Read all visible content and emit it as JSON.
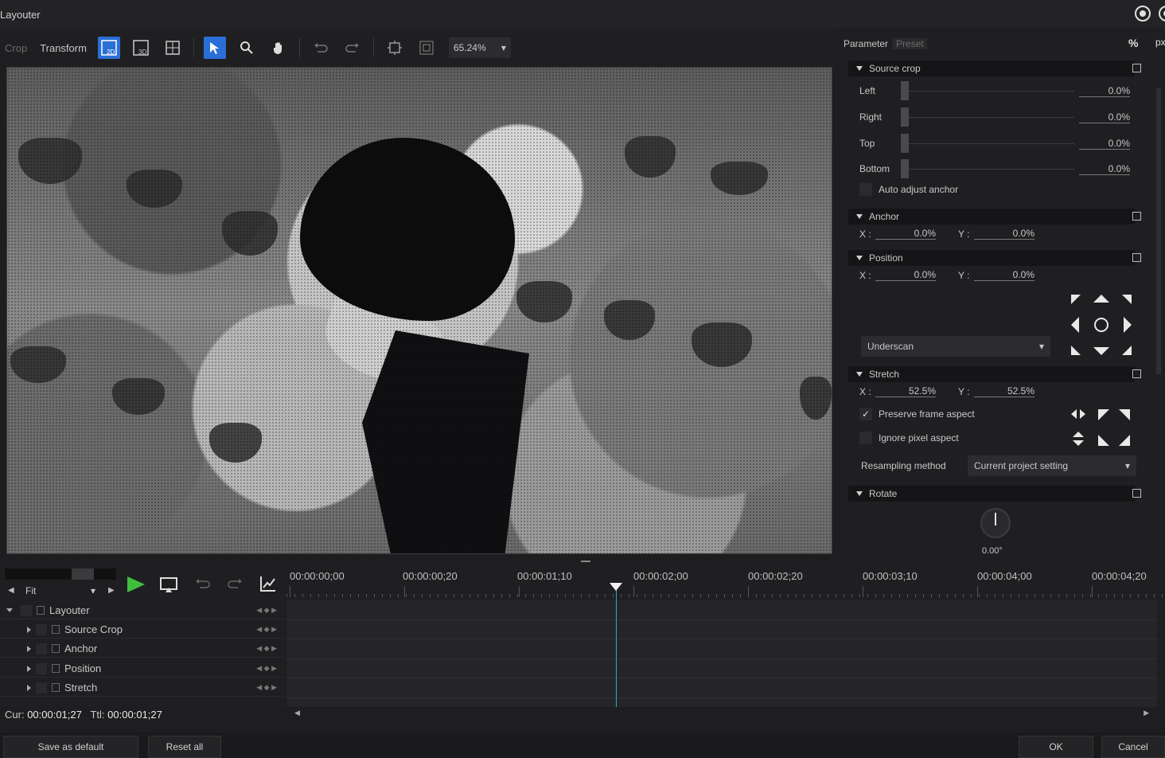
{
  "window": {
    "title": "Layouter"
  },
  "toolbar": {
    "crop_label": "Crop",
    "transform_label": "Transform",
    "zoom": "65.24%",
    "icons": [
      "view-2d-icon",
      "view-3d-icon",
      "grid-icon",
      "select-arrow-icon",
      "zoom-icon",
      "hand-icon",
      "undo-icon",
      "redo-icon",
      "fit-frame-icon",
      "safe-area-icon"
    ]
  },
  "panel": {
    "tab_parameter": "Parameter",
    "tab_preset": "Preset",
    "unit_percent": "%",
    "unit_px": "px",
    "source_crop": {
      "title": "Source crop",
      "left_label": "Left",
      "left_value": "0.0%",
      "right_label": "Right",
      "right_value": "0.0%",
      "top_label": "Top",
      "top_value": "0.0%",
      "bottom_label": "Bottom",
      "bottom_value": "0.0%",
      "auto_adjust_label": "Auto adjust anchor"
    },
    "anchor": {
      "title": "Anchor",
      "x_label": "X :",
      "x_value": "0.0%",
      "y_label": "Y :",
      "y_value": "0.0%"
    },
    "position": {
      "title": "Position",
      "x_label": "X :",
      "x_value": "0.0%",
      "y_label": "Y :",
      "y_value": "0.0%",
      "fit_mode": "Underscan"
    },
    "stretch": {
      "title": "Stretch",
      "x_label": "X :",
      "x_value": "52.5%",
      "y_label": "Y :",
      "y_value": "52.5%",
      "preserve_label": "Preserve frame aspect",
      "preserve_checked": true,
      "ignore_label": "Ignore pixel aspect",
      "ignore_checked": false,
      "resampling_label": "Resampling method",
      "resampling_value": "Current project setting"
    },
    "rotate": {
      "title": "Rotate",
      "value": "0.00°"
    }
  },
  "timeline": {
    "fit_label": "Fit",
    "tree": [
      {
        "label": "Layouter",
        "level": 0
      },
      {
        "label": "Source Crop",
        "level": 1
      },
      {
        "label": "Anchor",
        "level": 1
      },
      {
        "label": "Position",
        "level": 1
      },
      {
        "label": "Stretch",
        "level": 1
      }
    ],
    "ruler": [
      "00:00:00;00",
      "00:00:00;20",
      "00:00:01;10",
      "00:00:02;00",
      "00:00:02;20",
      "00:00:03;10",
      "00:00:04;00",
      "00:00:04;20"
    ],
    "cur_label": "Cur:",
    "cur_value": "00:00:01;27",
    "ttl_label": "Ttl:",
    "ttl_value": "00:00:01;27"
  },
  "footer": {
    "save_default": "Save as default",
    "reset_all": "Reset all",
    "ok": "OK",
    "cancel": "Cancel"
  },
  "colors": {
    "accent": "#2a6fd6",
    "play": "#3fbf3f",
    "playhead": "#2fa7c8"
  }
}
